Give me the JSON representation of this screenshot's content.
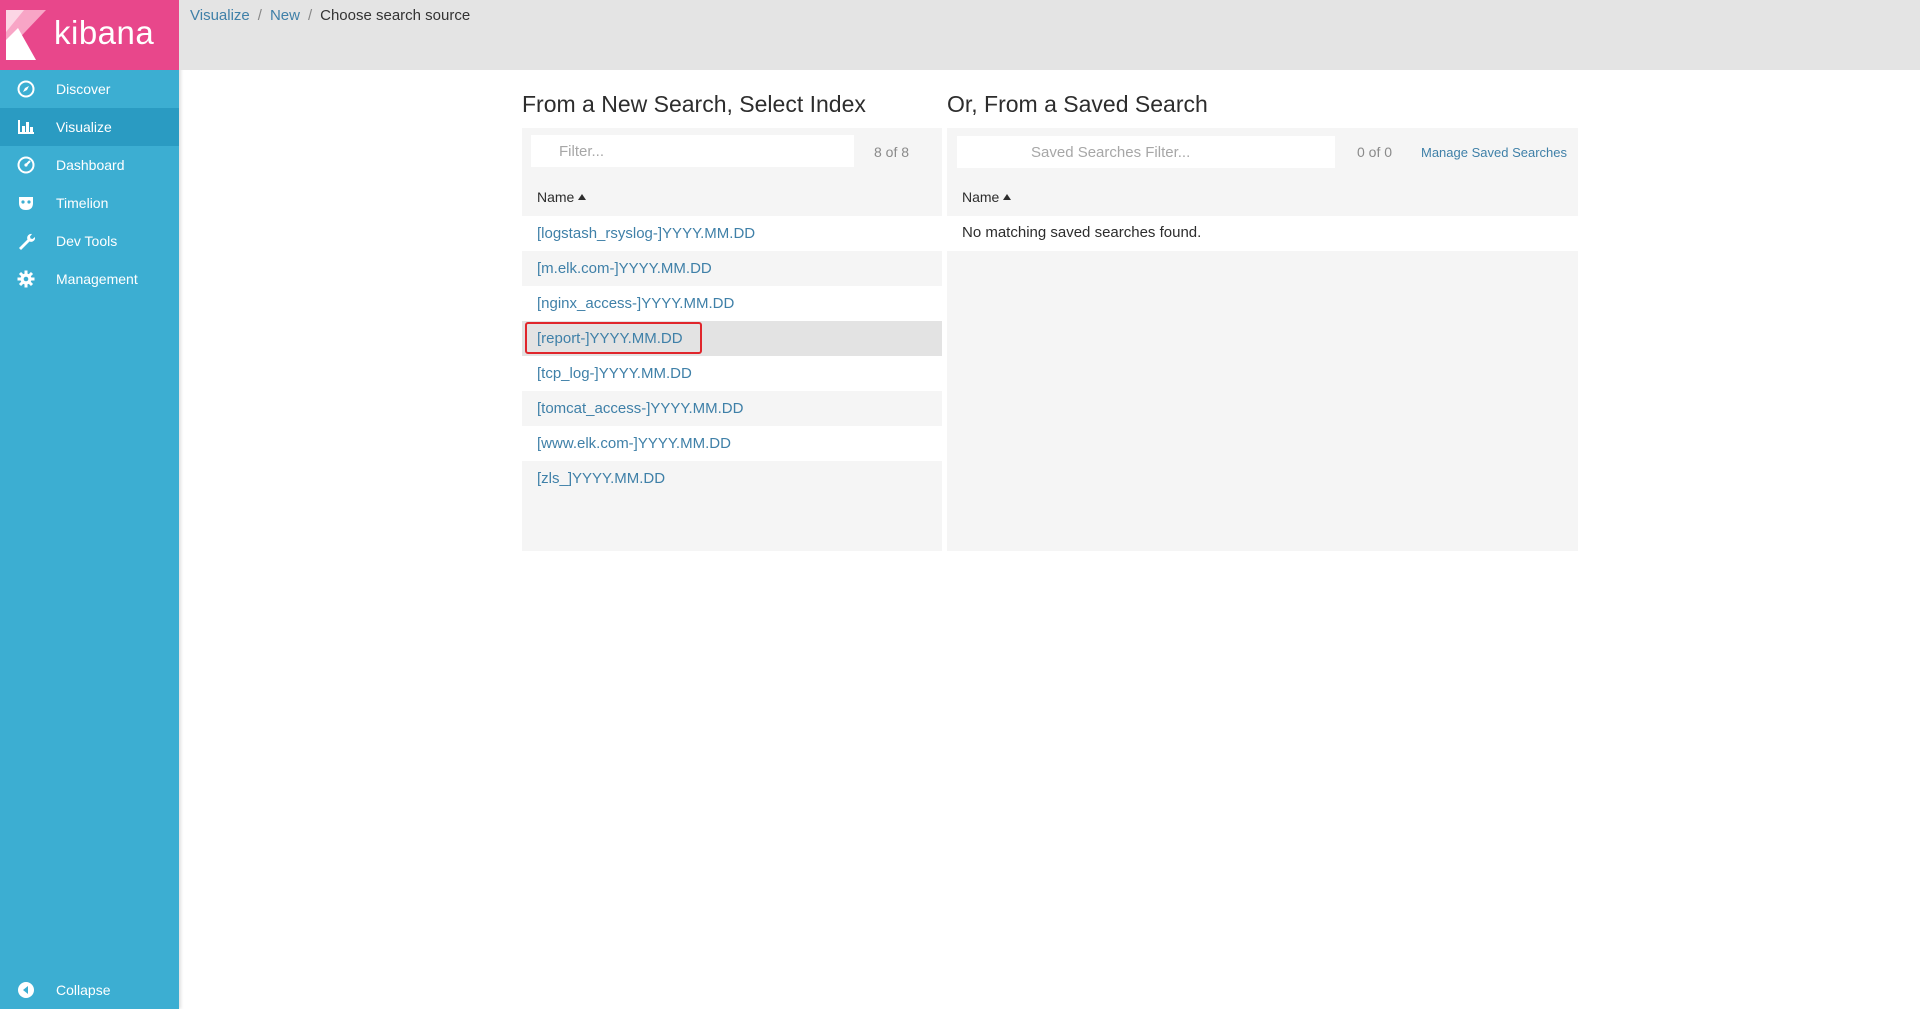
{
  "app": {
    "logo_text": "kibana"
  },
  "sidebar": {
    "items": [
      {
        "label": "Discover",
        "icon": "compass-icon",
        "active": false
      },
      {
        "label": "Visualize",
        "icon": "bar-chart-icon",
        "active": true
      },
      {
        "label": "Dashboard",
        "icon": "dashboard-gauge-icon",
        "active": false
      },
      {
        "label": "Timelion",
        "icon": "timelion-mask-icon",
        "active": false
      },
      {
        "label": "Dev Tools",
        "icon": "wrench-icon",
        "active": false
      },
      {
        "label": "Management",
        "icon": "gear-icon",
        "active": false
      }
    ],
    "collapse_label": "Collapse"
  },
  "breadcrumb": {
    "items": [
      "Visualize",
      "New"
    ],
    "separator": "/",
    "current": "Choose search source"
  },
  "new_search": {
    "title": "From a New Search, Select Index",
    "filter_placeholder": "Filter...",
    "count": "8 of 8",
    "column_header": "Name",
    "indices": [
      "[logstash_rsyslog-]YYYY.MM.DD",
      "[m.elk.com-]YYYY.MM.DD",
      "[nginx_access-]YYYY.MM.DD",
      "[report-]YYYY.MM.DD",
      "[tcp_log-]YYYY.MM.DD",
      "[tomcat_access-]YYYY.MM.DD",
      "[www.elk.com-]YYYY.MM.DD",
      "[zls_]YYYY.MM.DD"
    ],
    "selected_index": "[report-]YYYY.MM.DD"
  },
  "saved_search": {
    "title": "Or, From a Saved Search",
    "filter_placeholder": "Saved Searches Filter...",
    "count": "0 of 0",
    "manage_label": "Manage Saved Searches",
    "column_header": "Name",
    "empty_message": "No matching saved searches found."
  },
  "colors": {
    "sidebar": "#3caed2",
    "logo": "#e8478b",
    "link": "#3f80a8",
    "highlight": "#e0262c"
  }
}
